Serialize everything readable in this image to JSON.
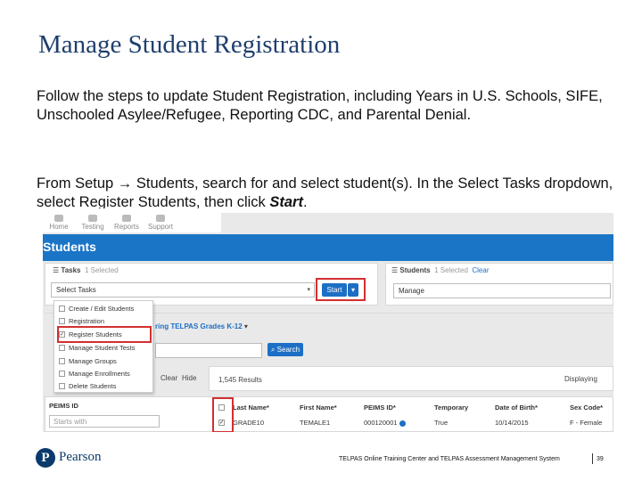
{
  "slide": {
    "title": "Manage Student Registration",
    "paragraph1": "Follow the steps to update Student Registration, including Years in U.S. Schools, SIFE, Unschooled Asylee/Refugee, Reporting CDC, and Parental Denial.",
    "paragraph2_prefix": "From Setup → Students, search for and select student(s). In the Select Tasks dropdown, select Register Students, then click ",
    "paragraph2_emph": "Start",
    "paragraph2_suffix": "."
  },
  "screenshot": {
    "toolbar": [
      "Home",
      "Testing",
      "Reports",
      "Support"
    ],
    "banner_title": "Students",
    "tasks_panel": {
      "label": "Tasks",
      "selected": "1 Selected",
      "select_value": "Select Tasks",
      "start_label": "Start",
      "split_caret": "▾"
    },
    "students_panel": {
      "label": "Students",
      "selected": "1 Selected",
      "clear": "Clear",
      "select_value": "Manage"
    },
    "dropdown_items": [
      {
        "label": "Create / Edit Students",
        "checked": false
      },
      {
        "label": "Registration",
        "checked": false
      },
      {
        "label": "Register Students",
        "checked": true
      },
      {
        "label": "Manage Student Tests",
        "checked": false
      },
      {
        "label": "Manage Groups",
        "checked": false
      },
      {
        "label": "Manage Enrollments",
        "checked": false
      },
      {
        "label": "Delete Students",
        "checked": false
      }
    ],
    "filter_text": "ring TELPAS Grades K-12",
    "search_label": "Search",
    "clear_link": "Clear",
    "hide_link": "Hide",
    "results": "1,545 Results",
    "displaying": "Displaying",
    "peims_label": "PEIMS ID",
    "peims_placeholder": "Starts with",
    "table_headers": [
      "Last Name*",
      "First Name*",
      "PEIMS ID*",
      "Temporary",
      "Date of Birth*",
      "Sex Code*"
    ],
    "table_row": [
      "GRADE10",
      "TEMALE1",
      "000120001",
      "True",
      "10/14/2015",
      "F - Female"
    ]
  },
  "footer": {
    "logo_letter": "P",
    "brand": "Pearson",
    "text": "TELPAS Online Training Center and TELPAS Assessment Management System",
    "page": "39"
  }
}
